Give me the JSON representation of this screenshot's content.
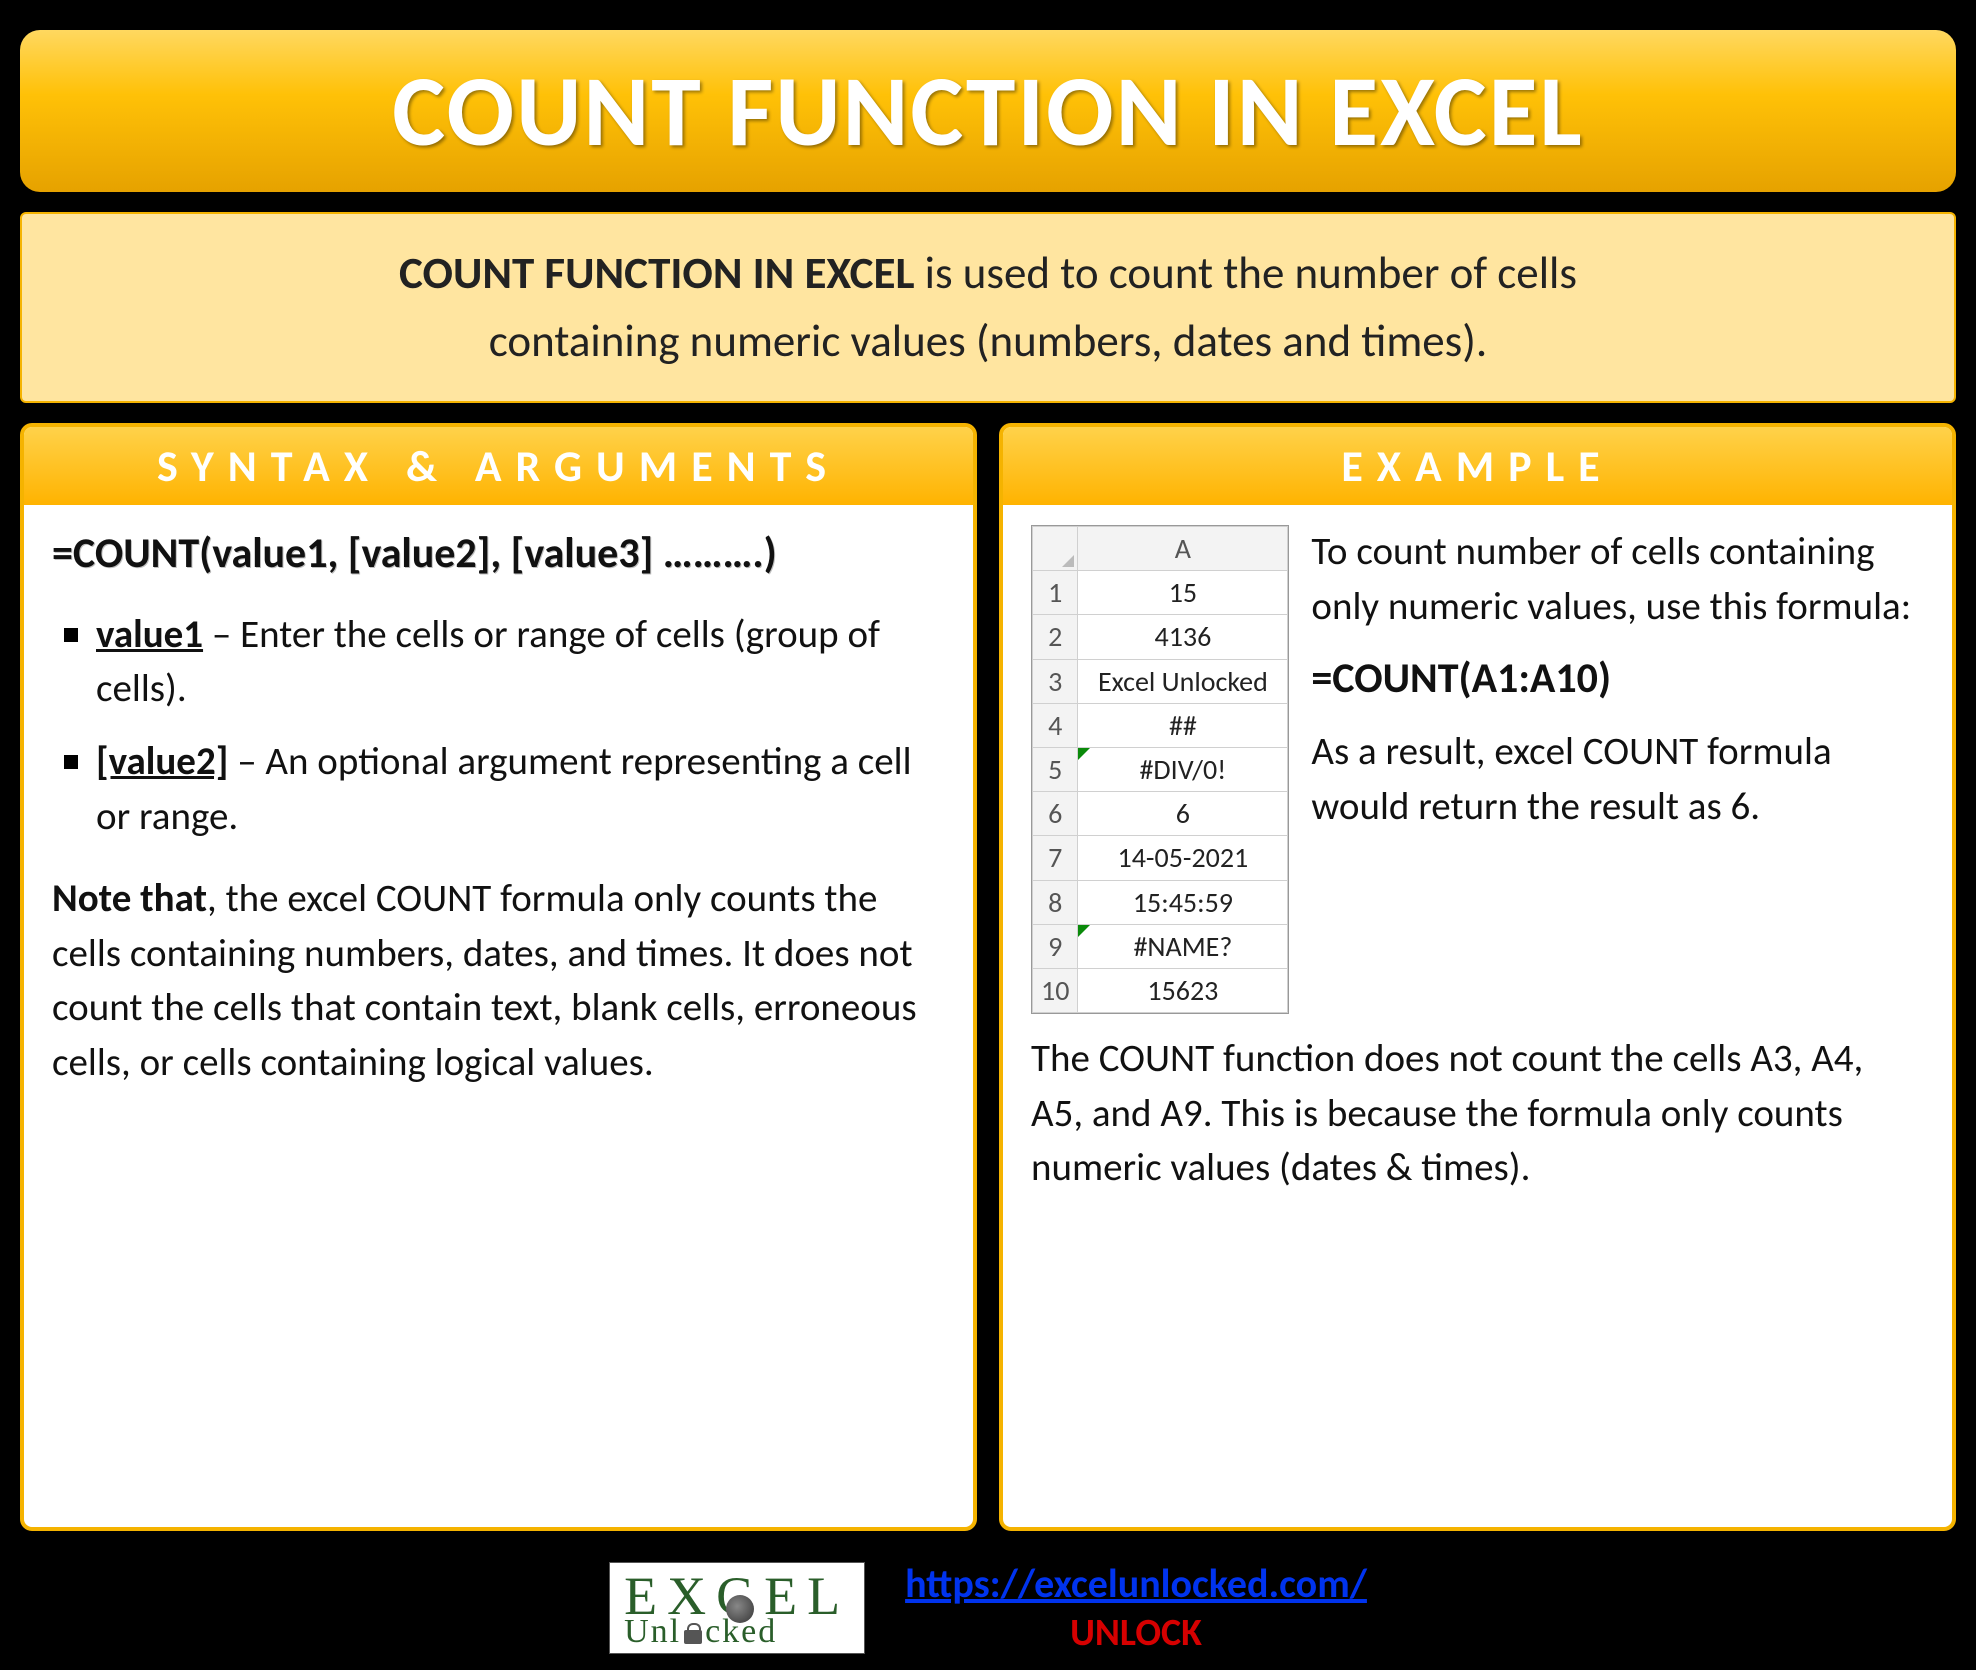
{
  "title": "COUNT FUNCTION IN EXCEL",
  "intro": {
    "bold": "COUNT FUNCTION IN EXCEL",
    "rest1": " is used to count the number of cells",
    "line2": "containing numeric values (numbers, dates and times)."
  },
  "syntax": {
    "header": "SYNTAX & ARGUMENTS",
    "formula": "=COUNT(value1, [value2], [value3] ……….)",
    "args": [
      {
        "name": "value1",
        "desc": " – Enter the cells or range of cells (group of cells)."
      },
      {
        "name": "[value2]",
        "desc": " – An optional argument representing a cell or range."
      }
    ],
    "note_label": "Note that",
    "note_rest": ", the excel COUNT formula only counts the cells containing numbers, dates, and times. It does not count the cells that contain text, blank cells, erroneous cells, or cells containing logical values."
  },
  "example": {
    "header": "EXAMPLE",
    "col_label": "A",
    "rows": [
      {
        "n": "1",
        "v": "15",
        "err": false
      },
      {
        "n": "2",
        "v": "4136",
        "err": false
      },
      {
        "n": "3",
        "v": "Excel Unlocked",
        "err": false
      },
      {
        "n": "4",
        "v": "##",
        "err": false
      },
      {
        "n": "5",
        "v": "#DIV/0!",
        "err": true
      },
      {
        "n": "6",
        "v": "6",
        "err": false
      },
      {
        "n": "7",
        "v": "14-05-2021",
        "err": false
      },
      {
        "n": "8",
        "v": "15:45:59",
        "err": false
      },
      {
        "n": "9",
        "v": "#NAME?",
        "err": true
      },
      {
        "n": "10",
        "v": "15623",
        "err": false
      }
    ],
    "right_p1": "To count number of cells containing only numeric values, use this formula:",
    "right_formula": "=COUNT(A1:A10)",
    "right_p2": "As a result, excel COUNT formula would return the result as 6.",
    "bottom": "The COUNT function does not count the cells A3, A4, A5, and A9. This is because the formula only counts numeric values (dates & times)."
  },
  "footer": {
    "logo_top_E": "E",
    "logo_top_X": "X",
    "logo_top_E2": "E",
    "logo_top_L": "L",
    "logo_bottom_pre": "Unl",
    "logo_bottom_post": "cked",
    "url": "https://excelunlocked.com/",
    "unlock": "UNLOCK"
  }
}
